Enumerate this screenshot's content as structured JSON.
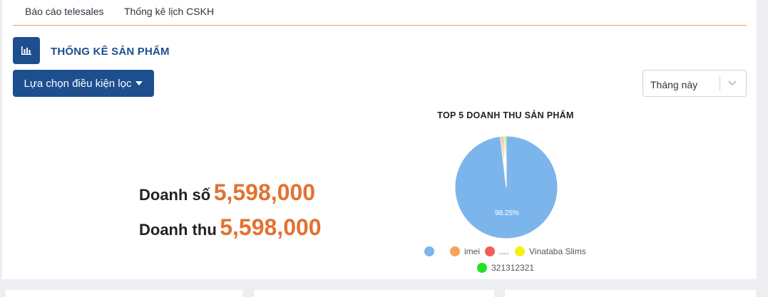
{
  "tabs": [
    {
      "label": "Báo cáo telesales"
    },
    {
      "label": "Thống kê lịch CSKH"
    }
  ],
  "section": {
    "title": "THỐNG KÊ SẢN PHẨM",
    "icon": "bar-chart-icon"
  },
  "filter": {
    "button_label": "Lựa chọn điều kiện lọc",
    "period_value": "Tháng này"
  },
  "metrics": {
    "sales_label": "Doanh số",
    "sales_value": "5,598,000",
    "revenue_label": "Doanh thu",
    "revenue_value": "5,598,000"
  },
  "chart_data": {
    "type": "pie",
    "title": "TOP 5 DOANH THU SẢN PHẨM",
    "labels": [
      "",
      "imei",
      "....",
      "Vinataba Slims",
      "321312321"
    ],
    "values": [
      98.25,
      0.5,
      0.45,
      0.4,
      0.4
    ],
    "colors": [
      "#7cb5ec",
      "#f7a35c",
      "#f15c5c",
      "#f2f20f",
      "#22e022"
    ],
    "data_labels": [
      "98.25%"
    ]
  },
  "colors": {
    "primary": "#1d4f8f",
    "accent": "#e2722f"
  }
}
